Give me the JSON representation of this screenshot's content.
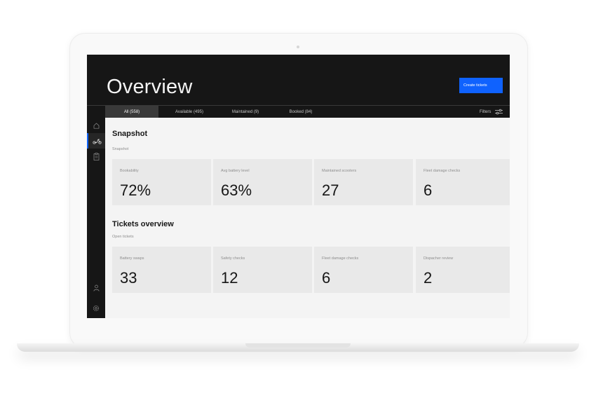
{
  "header": {
    "title": "Overview",
    "create_label": "Create tickets"
  },
  "tabs": [
    {
      "label": "All (558)",
      "active": true
    },
    {
      "label": "Available (495)",
      "active": false
    },
    {
      "label": "Maintained (9)",
      "active": false
    },
    {
      "label": "Booked (84)",
      "active": false
    }
  ],
  "filters": {
    "label": "Filters",
    "icon": "sliders-icon"
  },
  "sidebar": {
    "icons": [
      "home-icon",
      "scooter-icon",
      "clipboard-icon",
      "user-icon",
      "settings-icon"
    ],
    "active": "scooter-icon"
  },
  "snapshot": {
    "title": "Snapshot",
    "subtitle": "Snapshot",
    "tiles": [
      {
        "label": "Bookability",
        "value": "72%"
      },
      {
        "label": "Avg battery level",
        "value": "63%"
      },
      {
        "label": "Maintained scooters",
        "value": "27"
      },
      {
        "label": "Fleet damage checks",
        "value": "6"
      }
    ]
  },
  "tickets": {
    "title": "Tickets overview",
    "subtitle": "Open tickets",
    "tiles": [
      {
        "label": "Battery swaps",
        "value": "33"
      },
      {
        "label": "Safety checks",
        "value": "12"
      },
      {
        "label": "Fleet damage checks",
        "value": "6"
      },
      {
        "label": "Dispacher review",
        "value": "2"
      }
    ]
  },
  "colors": {
    "accent": "#0f62fe",
    "header_bg": "#161616",
    "content_bg": "#f4f4f4",
    "tile_bg": "#e9e9e9"
  }
}
